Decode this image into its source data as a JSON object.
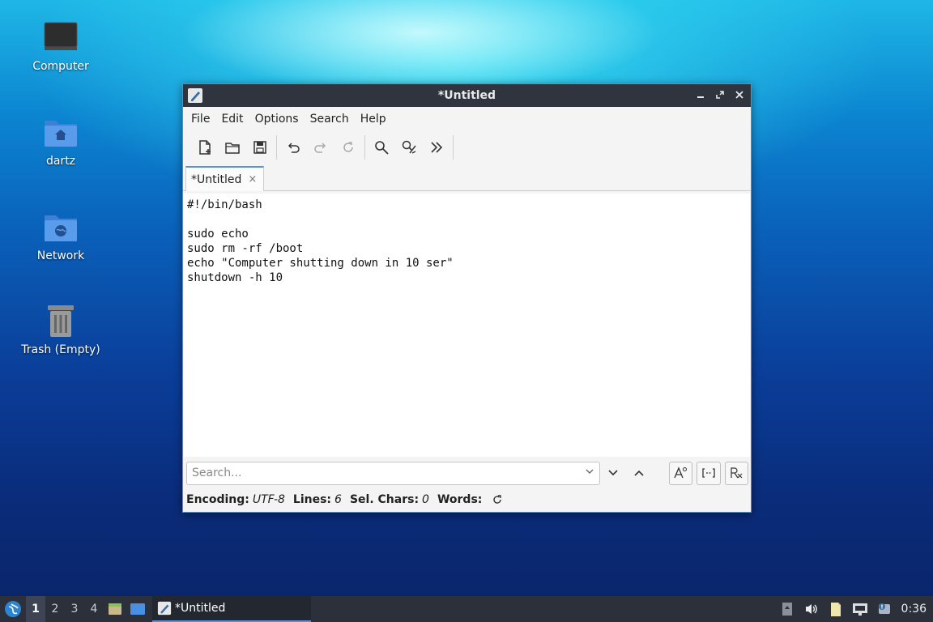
{
  "desktop": {
    "icons": [
      {
        "label": "Computer"
      },
      {
        "label": "dartz"
      },
      {
        "label": "Network"
      },
      {
        "label": "Trash (Empty)"
      }
    ]
  },
  "window": {
    "title": "*Untitled",
    "menu": [
      "File",
      "Edit",
      "Options",
      "Search",
      "Help"
    ],
    "tab": {
      "label": "*Untitled",
      "close": "×"
    },
    "editor_lines": [
      "#!/bin/bash",
      "",
      "sudo echo",
      "sudo rm -rf /boot",
      "echo \"Computer shutting down in 10 ser\"",
      "shutdown -h 10"
    ],
    "search": {
      "placeholder": "Search..."
    },
    "status": {
      "encoding_label": "Encoding:",
      "encoding_value": "UTF-8",
      "lines_label": "Lines:",
      "lines_value": "6",
      "sel_label": "Sel. Chars:",
      "sel_value": "0",
      "words_label": "Words:"
    }
  },
  "taskbar": {
    "workspaces": [
      "1",
      "2",
      "3",
      "4"
    ],
    "task_label": "*Untitled",
    "clock": "0:36"
  },
  "colors": {
    "accent": "#5294e2",
    "titlebar": "#2f343f",
    "panel": "#2b303b"
  }
}
